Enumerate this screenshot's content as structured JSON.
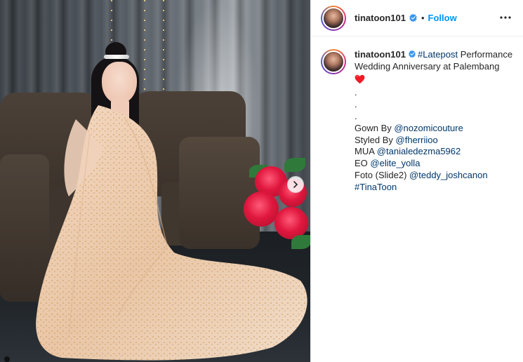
{
  "post": {
    "username": "tinatoon101",
    "separator": "•",
    "follow_label": "Follow",
    "more_icon": "more-horizontal-icon"
  },
  "caption": {
    "username": "tinatoon101",
    "hashtag_latepost": "#Latepost",
    "text_after_hashtag": " Performance",
    "line2": "Wedding Anniversary at Palembang",
    "dot1": ".",
    "dot2": ".",
    "dot3": ".",
    "gown_label": "Gown By ",
    "gown_handle": "@nozomicouture",
    "styled_label": "Styled By ",
    "styled_handle": "@fherriioo",
    "mua_label": "MUA ",
    "mua_handle": "@tanialedezma5962",
    "eo_label": "EO ",
    "eo_handle": "@elite_yolla",
    "foto_label": "Foto (Slide2) ",
    "foto_handle": "@teddy_joshcanon",
    "hashtag_tinatoon": "#TinaToon"
  },
  "colors": {
    "link": "#00376b",
    "follow": "#0095f6",
    "verified": "#3897f0",
    "heart": "#ed1c24"
  }
}
